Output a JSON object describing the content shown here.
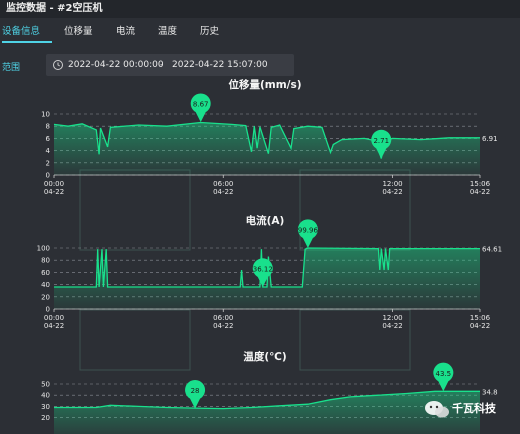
{
  "window": {
    "title": "监控数据 - #2空压机"
  },
  "tabs": [
    {
      "label": "设备信息",
      "active": true
    },
    {
      "label": "位移量",
      "active": false
    },
    {
      "label": "电流",
      "active": false
    },
    {
      "label": "温度",
      "active": false
    },
    {
      "label": "历史",
      "active": false
    }
  ],
  "range": {
    "label": "范围",
    "start": "2022-04-22 00:00:00",
    "separator": "-",
    "end": "2022-04-22 15:07:00",
    "icon": "clock-icon"
  },
  "colors": {
    "accent": "#4fd3e6",
    "series": "#19e08c",
    "background": "#2c2f35"
  },
  "watermark": {
    "text": "千瓦科技",
    "icon": "wechat-icon"
  },
  "chart_data": [
    {
      "type": "line",
      "title": "位移量(mm/s)",
      "ylim": [
        0,
        10
      ],
      "yticks": [
        0,
        2,
        4,
        6,
        8,
        10
      ],
      "xlim_hours": [
        0,
        15.1
      ],
      "xticks": [
        {
          "h": 0,
          "label": [
            "00:00",
            "04-22"
          ]
        },
        {
          "h": 6,
          "label": [
            "06:00",
            "04-22"
          ]
        },
        {
          "h": 12,
          "label": [
            "12:00",
            "04-22"
          ]
        },
        {
          "h": 15.1,
          "label": [
            "15:06",
            "04-22"
          ]
        }
      ],
      "series": [
        {
          "color": "#19e08c",
          "points": [
            [
              0,
              8.3
            ],
            [
              0.5,
              8.0
            ],
            [
              1.0,
              8.4
            ],
            [
              1.5,
              7.4
            ],
            [
              1.6,
              3.4
            ],
            [
              1.65,
              7.7
            ],
            [
              1.9,
              4.6
            ],
            [
              2.0,
              7.8
            ],
            [
              3.0,
              8.2
            ],
            [
              4.0,
              8.0
            ],
            [
              5.2,
              8.6
            ],
            [
              6.3,
              8.3
            ],
            [
              6.8,
              8.1
            ],
            [
              7.0,
              3.8
            ],
            [
              7.1,
              8.0
            ],
            [
              7.2,
              4.4
            ],
            [
              7.3,
              7.9
            ],
            [
              7.6,
              3.5
            ],
            [
              7.7,
              7.8
            ],
            [
              8.0,
              8.2
            ],
            [
              8.4,
              4.4
            ],
            [
              8.5,
              7.6
            ],
            [
              9.0,
              8.0
            ],
            [
              9.5,
              7.8
            ],
            [
              9.8,
              3.7
            ],
            [
              9.9,
              5.0
            ],
            [
              10.2,
              5.8
            ],
            [
              11.0,
              6.0
            ],
            [
              11.4,
              5.6
            ],
            [
              11.6,
              2.7
            ],
            [
              11.7,
              5.5
            ],
            [
              12.0,
              6.0
            ],
            [
              13.0,
              5.8
            ],
            [
              14.0,
              6.1
            ],
            [
              15.1,
              6.1
            ]
          ]
        }
      ],
      "markers": [
        {
          "x": 5.2,
          "y": 8.67,
          "label": "8.67"
        },
        {
          "x": 11.6,
          "y": 2.71,
          "label": "2.71"
        }
      ],
      "last_value": "6.91"
    },
    {
      "type": "line",
      "title": "电流(A)",
      "ylim": [
        0,
        100
      ],
      "yticks": [
        0,
        20,
        40,
        60,
        80,
        100
      ],
      "xlim_hours": [
        0,
        15.1
      ],
      "xticks": [
        {
          "h": 0,
          "label": [
            "00:00",
            "04-22"
          ]
        },
        {
          "h": 6,
          "label": [
            "06:00",
            "04-22"
          ]
        },
        {
          "h": 12,
          "label": [
            "12:00",
            "04-22"
          ]
        },
        {
          "h": 15.1,
          "label": [
            "15:06",
            "04-22"
          ]
        }
      ],
      "series": [
        {
          "color": "#19e08c",
          "points": [
            [
              0,
              36
            ],
            [
              1.5,
              36
            ],
            [
              1.55,
              98
            ],
            [
              1.6,
              36
            ],
            [
              1.7,
              98
            ],
            [
              1.75,
              36
            ],
            [
              1.85,
              98
            ],
            [
              1.9,
              36
            ],
            [
              6.0,
              36
            ],
            [
              6.6,
              36
            ],
            [
              6.65,
              64
            ],
            [
              6.7,
              36
            ],
            [
              7.3,
              36
            ],
            [
              7.35,
              98
            ],
            [
              7.4,
              36
            ],
            [
              7.55,
              36
            ],
            [
              7.6,
              86
            ],
            [
              7.7,
              36
            ],
            [
              8.8,
              36
            ],
            [
              8.9,
              98
            ],
            [
              9.0,
              99.96
            ],
            [
              11.5,
              99
            ],
            [
              11.55,
              64
            ],
            [
              11.6,
              99
            ],
            [
              11.7,
              64
            ],
            [
              11.75,
              99
            ],
            [
              11.85,
              64
            ],
            [
              11.9,
              99
            ],
            [
              15.1,
              99
            ]
          ]
        }
      ],
      "markers": [
        {
          "x": 7.4,
          "y": 36.12,
          "label": "36.12"
        },
        {
          "x": 9.0,
          "y": 99.96,
          "label": "99.96"
        }
      ],
      "last_value": "64.61"
    },
    {
      "type": "line",
      "title": "温度(℃)",
      "ylim": [
        0,
        50
      ],
      "yticks": [
        20,
        30,
        40,
        50
      ],
      "xlim_hours": [
        0,
        15.1
      ],
      "series": [
        {
          "color": "#19e08c",
          "points": [
            [
              0,
              29
            ],
            [
              1.5,
              29
            ],
            [
              2.0,
              31
            ],
            [
              3.0,
              30
            ],
            [
              4.0,
              29
            ],
            [
              5.0,
              28.5
            ],
            [
              6.0,
              28
            ],
            [
              7.0,
              29
            ],
            [
              8.0,
              30.5
            ],
            [
              9.0,
              32
            ],
            [
              9.8,
              36
            ],
            [
              10.5,
              38.5
            ],
            [
              11.5,
              40
            ],
            [
              12.5,
              41.5
            ],
            [
              13.5,
              43.5
            ],
            [
              15.1,
              43.5
            ]
          ]
        }
      ],
      "markers": [
        {
          "x": 5.0,
          "y": 28,
          "label": "28"
        },
        {
          "x": 13.8,
          "y": 43.5,
          "label": "43.5"
        }
      ],
      "last_value": "34.8"
    }
  ]
}
